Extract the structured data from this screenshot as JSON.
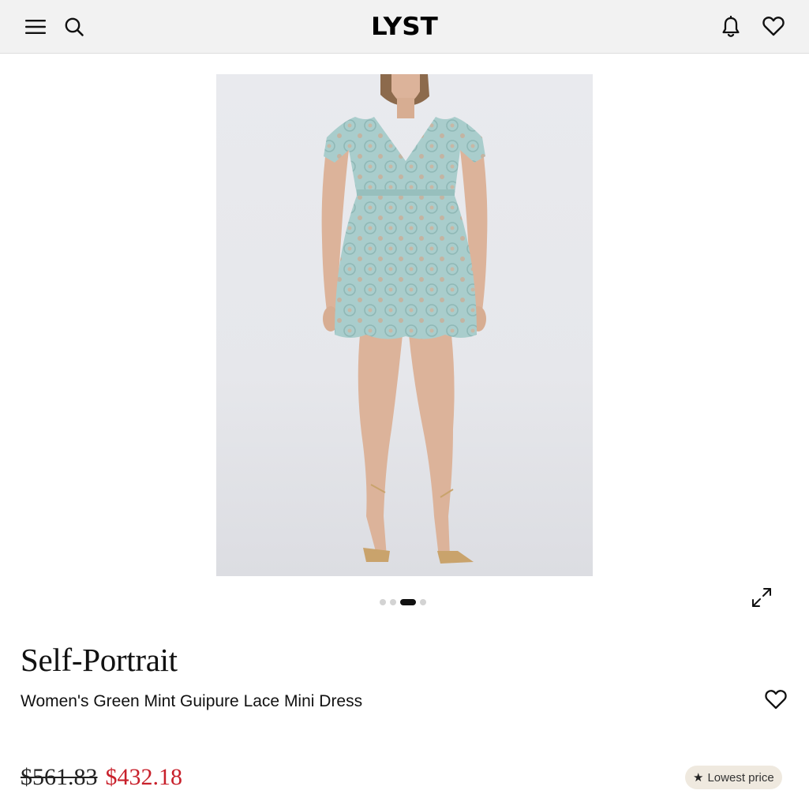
{
  "header": {
    "logo": "LYST",
    "icons": {
      "menu": "menu-icon",
      "search": "search-icon",
      "notifications": "bell-icon",
      "wishlist": "heart-icon"
    }
  },
  "product": {
    "image_alt": "Model wearing a mint green guipure lace mini dress",
    "carousel": {
      "total": 4,
      "active_index": 2
    },
    "brand": "Self-Portrait",
    "name": "Women's Green Mint Guipure Lace Mini Dress",
    "price": {
      "original": "$561.83",
      "sale": "$432.18"
    },
    "badge": "Lowest price"
  },
  "colors": {
    "sale_price": "#c8202b",
    "header_bg": "#f2f2f2",
    "badge_bg": "#efe9df",
    "dress": "#a9cdcc"
  }
}
